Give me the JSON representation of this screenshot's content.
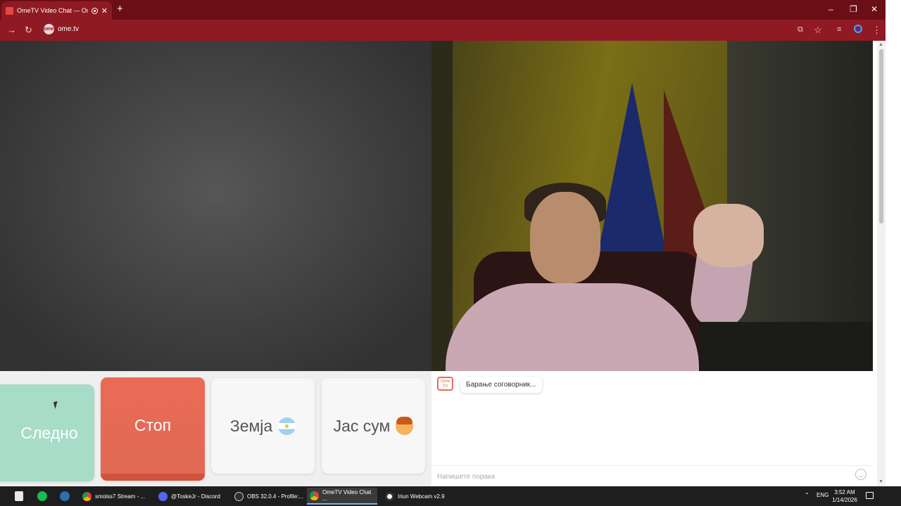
{
  "browser": {
    "tab": {
      "title": "OmeTV Video Chat — Ome",
      "close": "✕"
    },
    "new_tab": "+",
    "window": {
      "minimize": "–",
      "maximize": "❐",
      "close": "✕"
    },
    "nav": {
      "forward": "→",
      "reload": "↻"
    },
    "url_badge": "ome",
    "url": "ome.tv",
    "icons": [
      "forward-icon",
      "reload-icon",
      "site-info-icon",
      "cast-icon",
      "bookmark-star-icon",
      "media-icon",
      "profile-icon",
      "menu-icon"
    ],
    "accent": "#8f1a23"
  },
  "video": {
    "left": "static-noise",
    "right": "remote-webcam"
  },
  "controls": {
    "next_label": "Следно",
    "stop_label": "Стоп",
    "country_label": "Земја",
    "gender_label": "Јас сум",
    "colors": {
      "next": "#a6dcc8",
      "stop": "#ea6b55"
    }
  },
  "chat": {
    "logo_text": "Ome TV",
    "status_message": "Барање соговорник...",
    "input_placeholder": "Напишете порака"
  },
  "taskbar": {
    "items": [
      {
        "label": "smolss7 Stream - ...",
        "icon": "chrome-icon"
      },
      {
        "label": "@ToskeJr - Discord",
        "icon": "discord-icon"
      },
      {
        "label": "OBS 32.0.4 - Profile:...",
        "icon": "obs-icon"
      },
      {
        "label": "OmeTV Video Chat ...",
        "icon": "chrome-icon",
        "active": true
      },
      {
        "label": "Iriun Webcam v2.9",
        "icon": "iriun-icon"
      }
    ],
    "pinned": [
      "epic-games-icon",
      "spotify-icon",
      "steam-icon"
    ],
    "language": "ENG",
    "time": "3:52 AM",
    "date": "1/14/2026"
  }
}
